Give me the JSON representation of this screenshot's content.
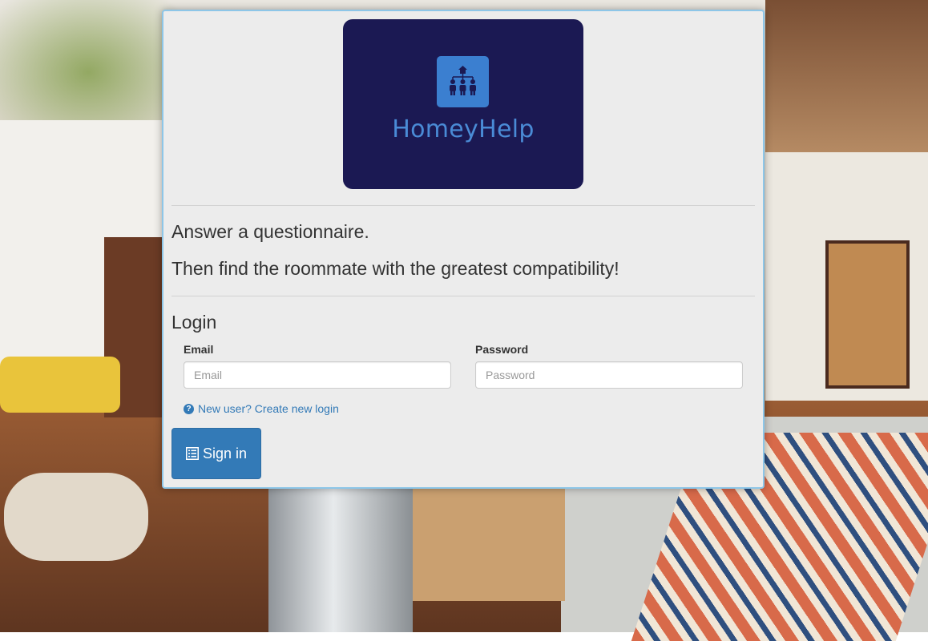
{
  "brand": {
    "name": "HomeyHelp",
    "logo_bg_color": "#1b1953",
    "logo_accent_color": "#3b7fd0",
    "icon": "people-hierarchy-icon"
  },
  "taglines": [
    "Answer a questionnaire.",
    "Then find the roommate with the greatest compatibility!"
  ],
  "login": {
    "title": "Login",
    "email_label": "Email",
    "email_placeholder": "Email",
    "email_value": "",
    "password_label": "Password",
    "password_placeholder": "Password",
    "password_value": "",
    "new_user_link": "New user? Create new login",
    "new_user_icon": "question-circle-icon",
    "signin_label": "Sign in",
    "signin_icon": "list-icon"
  },
  "colors": {
    "primary": "#337ab7",
    "panel_bg": "#ececec",
    "panel_border": "#8dc6e8"
  }
}
